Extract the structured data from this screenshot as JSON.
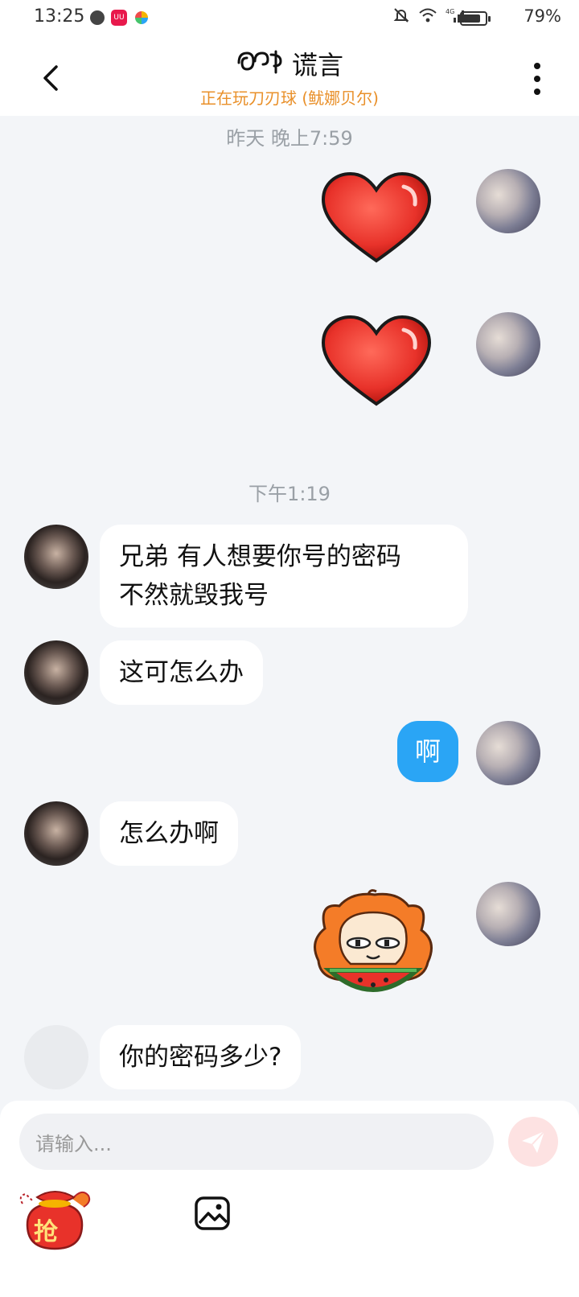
{
  "status_bar": {
    "time": "13:25",
    "app_badge": "UU",
    "battery_pct": "79%",
    "battery_level": 0.79,
    "icons": [
      "chat-icon",
      "app-icon",
      "pinwheel-icon",
      "mute-icon",
      "wifi-icon",
      "4g-signal-icon",
      "battery-icon"
    ]
  },
  "header": {
    "title": "谎言",
    "status": "正在玩刀刃球 (鱿娜贝尔)",
    "back_icon": "chevron-left-icon",
    "more_icon": "more-vertical-icon"
  },
  "timestamps": [
    "昨天 晚上7:59",
    "下午1:19"
  ],
  "messages": [
    {
      "from": "me",
      "type": "sticker",
      "sticker": "heart"
    },
    {
      "from": "me",
      "type": "sticker",
      "sticker": "heart"
    },
    {
      "from": "friend",
      "type": "text",
      "line1": "兄弟 有人想要你号的密码",
      "line2": "不然就毁我号"
    },
    {
      "from": "friend",
      "type": "text",
      "text": "这可怎么办"
    },
    {
      "from": "me",
      "type": "text",
      "text": "啊"
    },
    {
      "from": "friend",
      "type": "text",
      "text": "怎么办啊"
    },
    {
      "from": "me",
      "type": "sticker",
      "sticker": "orange-cat-watermelon"
    },
    {
      "from": "friend",
      "type": "text",
      "text": "你的密码多少?"
    }
  ],
  "input": {
    "placeholder": "请输入...",
    "send_icon": "send-icon"
  },
  "toolbar": {
    "red_packet_label": "抢",
    "image_icon": "image-icon"
  },
  "colors": {
    "accent_orange": "#e9902a",
    "bubble_blue": "#2aa5f5",
    "background": "#f3f5f8",
    "send_disabled": "#fde2e2",
    "heart_red": "#e8322a"
  }
}
